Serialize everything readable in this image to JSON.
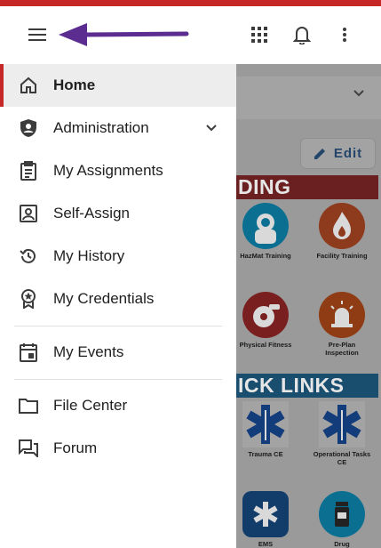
{
  "colors": {
    "brand_red": "#c62828",
    "annotation_arrow": "#5c2d91",
    "icon_gray": "#3c3c3c"
  },
  "app_bar": {
    "menu_icon": "hamburger-menu-icon",
    "apps_icon": "apps-grid-icon",
    "notifications_icon": "bell-icon",
    "more_icon": "more-vertical-icon"
  },
  "background": {
    "edit_label": "Edit",
    "training_banner": "DING",
    "links_banner": "ICK LINKS",
    "tiles": [
      {
        "label": "HazMat Training"
      },
      {
        "label": "Facility Training"
      },
      {
        "label": "Physical Fitness"
      },
      {
        "label": "Pre-Plan Inspection"
      },
      {
        "label": "Trauma CE"
      },
      {
        "label": "Operational Tasks CE"
      },
      {
        "label": "EMS"
      },
      {
        "label": "Drug"
      }
    ]
  },
  "drawer": {
    "items": [
      {
        "label": "Home",
        "icon": "home-icon",
        "active": true
      },
      {
        "label": "Administration",
        "icon": "shield-person-icon",
        "expandable": true
      },
      {
        "label": "My Assignments",
        "icon": "clipboard-icon"
      },
      {
        "label": "Self-Assign",
        "icon": "contact-card-icon"
      },
      {
        "label": "My History",
        "icon": "history-icon"
      },
      {
        "label": "My Credentials",
        "icon": "badge-award-icon"
      },
      {
        "label": "My Events",
        "icon": "calendar-event-icon"
      },
      {
        "label": "File Center",
        "icon": "folder-icon"
      },
      {
        "label": "Forum",
        "icon": "forum-icon"
      }
    ]
  }
}
